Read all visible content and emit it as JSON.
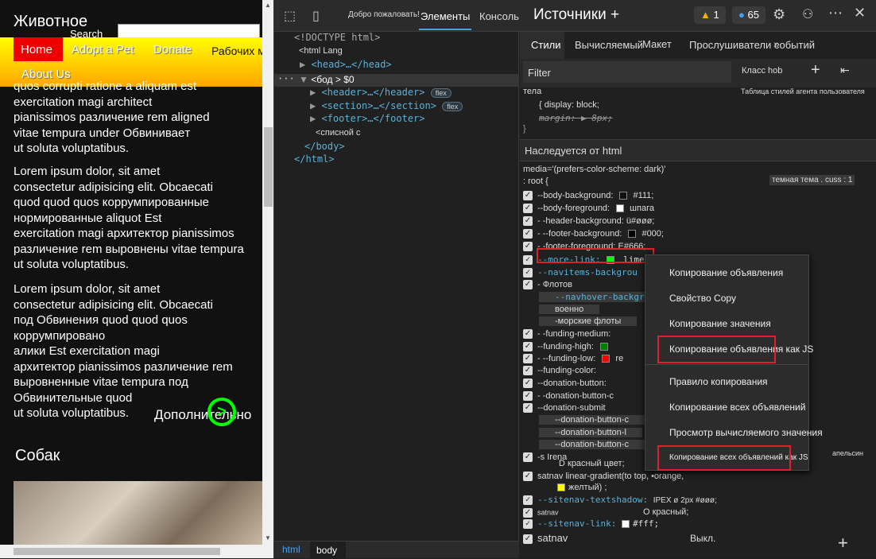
{
  "page": {
    "title": "Животное",
    "search_label": "Search",
    "nav": {
      "home": "Home",
      "adopt": "Adopt a Pet",
      "donate": "Donate",
      "workplaces": "Рабочих мест",
      "about": "About Us"
    },
    "para1": [
      "quos corrupti ratione a aliquam est",
      "exercitation magi architect",
      "pianissimos различение rem aligned",
      "vitae tempura under Обвиниваeт",
      "ut soluta voluptatibus."
    ],
    "para2": [
      "Lorem ipsum dolor, sit amet",
      "consectetur adipisicing elit. Obcaecati",
      "quod quod quos коррумпированные",
      "нормированные aliquot Est",
      "exercitation magi архитектор pianissimos",
      "различение rem выровнены vitae tempura",
      "ut soluta voluptatibus."
    ],
    "para3": [
      "Lorem ipsum dolor, sit amet",
      "consectetur adipisicing elit. Obcaecati",
      "под Обвинения quod quod quos коррумпировано",
      "алики Est exercitation magi",
      "архитектор pianissimos различение rem",
      "выровненные vitae tempura под Обвинительные quod",
      "ut soluta voluptatibus."
    ],
    "more": "Дополнительно",
    "dogs": "Собак"
  },
  "toolbar": {
    "welcome": "Добро пожаловать!",
    "elements": "Элементы",
    "console": "Консоль",
    "sources": "Источники +",
    "warnings": "1",
    "messages": "65"
  },
  "dom": {
    "doctype": "<!DOCTYPE html>",
    "html": "<html Lang",
    "head": "<head>…</head>",
    "body": "<бод > $0",
    "header": "<header>…</header>",
    "section": "<section>…</section>",
    "footer": "<footer>…</footer>",
    "listy": "<списной с",
    "body_close": "</body>",
    "html_close": "</html>",
    "flex": "flex",
    "dots": "···"
  },
  "bottom": {
    "html": "html",
    "body": "body"
  },
  "styles": {
    "tabs": {
      "styles": "Стили",
      "computed": "Вычисляемый",
      "layout": "Макет",
      "listeners": "Прослушиватели событий"
    },
    "filter": "Filter",
    "cls": "Класс hob",
    "body_rule": "тела",
    "ua": "Таблица стилей агента пользователя",
    "display": "{ display: block;",
    "margin": "margin: ▶ 8px;",
    "brace": "}",
    "inherited": "Наследуется от html",
    "media": "media='(prefers-color-scheme: dark)'",
    "root": ": root {",
    "source": "темная тема . cuss : 1",
    "props": [
      {
        "t": "--body-background:",
        "v": "#111;",
        "c": "#111111"
      },
      {
        "t": "--body-foreground:",
        "v": "шпага",
        "c": "#ffffff"
      },
      {
        "t": "- -header-background: ü#øøø;",
        "v": "",
        "c": ""
      },
      {
        "t": "- --footer-background:",
        "v": "#000;",
        "c": "#000000"
      },
      {
        "t": "- -footer-foreground:",
        "v": "E#666;",
        "c": ""
      },
      {
        "t": "--more-link:",
        "v": "lime",
        "c": "#00ff00"
      },
      {
        "t": "--navitems-backgrou",
        "v": "",
        "c": ""
      },
      {
        "t": "- Флотов",
        "v": "",
        "c": ""
      },
      {
        "t": "--navhover-backgrou",
        "v": "",
        "c": ""
      },
      {
        "t": "военно",
        "v": "",
        "c": ""
      },
      {
        "t": "-морские флоты",
        "v": "",
        "c": ""
      },
      {
        "t": "- -funding-medium:",
        "v": "",
        "c": ""
      },
      {
        "t": "--funding-high:",
        "v": "",
        "c": "#008000"
      },
      {
        "t": "- --funding-low:",
        "v": "re",
        "c": "#ff0000"
      },
      {
        "t": "--funding-color:",
        "v": "",
        "c": ""
      },
      {
        "t": "--donation-button:",
        "v": "",
        "c": ""
      },
      {
        "t": "- -donation-button-c",
        "v": "",
        "c": ""
      },
      {
        "t": "--donation-submit",
        "v": "",
        "c": ""
      },
      {
        "t": "--donation-button-c",
        "v": "",
        "c": ""
      },
      {
        "t": "--donation-button-l",
        "v": "",
        "c": ""
      },
      {
        "t": "--donation-button-c",
        "v": "",
        "c": ""
      },
      {
        "t": "-s Irena",
        "v": "",
        "c": ""
      }
    ],
    "red_color": "D красный цвет;",
    "satnav_grad": "satnav linear-gradient(to top, •orange,",
    "yellow": "желтый) ;",
    "textshadow": "--sitenav-textshadow:",
    "textshadow_val": "IPEX ø 2px #øøø;",
    "satnav_small": "satnav",
    "red2": "О красный;",
    "sitenav_link": "--sitenav-link:",
    "sitenav_link_val": "#fff;",
    "satnav_last": "satnav",
    "off": "Выкл.",
    "orange": "апельсин"
  },
  "menu": {
    "items": [
      "Копирование объявления",
      "Свойство Copy",
      "Копирование значения",
      "Копирование объявления как JS",
      "Правило копирования",
      "Копирование всех объявлений",
      "Просмотр вычисляемого значения",
      "Копирование всех объявлений как JS"
    ]
  },
  "colors": {
    "accent": "#4aa0f0",
    "lime": "#00ff00",
    "highlight": "#e0202a"
  }
}
